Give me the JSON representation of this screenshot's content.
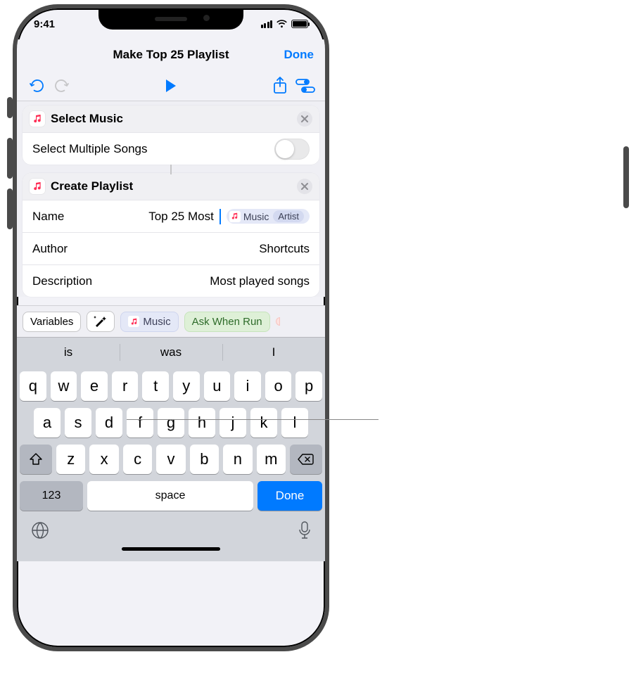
{
  "status": {
    "time": "9:41"
  },
  "header": {
    "title": "Make Top 25 Playlist",
    "done": "Done"
  },
  "actions": {
    "select_music": {
      "title": "Select Music",
      "option_label": "Select Multiple Songs",
      "option_on": false
    },
    "create_playlist": {
      "title": "Create Playlist",
      "fields": {
        "name_label": "Name",
        "name_text": "Top 25 Most ",
        "name_var": "Music",
        "name_subvar": "Artist",
        "author_label": "Author",
        "author_placeholder": "Shortcuts",
        "desc_label": "Description",
        "desc_value": "Most played songs"
      }
    }
  },
  "varbar": {
    "variables": "Variables",
    "music": "Music",
    "ask": "Ask When Run"
  },
  "predictive": [
    "is",
    "was",
    "I"
  ],
  "keyboard": {
    "row1": [
      "q",
      "w",
      "e",
      "r",
      "t",
      "y",
      "u",
      "i",
      "o",
      "p"
    ],
    "row2": [
      "a",
      "s",
      "d",
      "f",
      "g",
      "h",
      "j",
      "k",
      "l"
    ],
    "row3": [
      "z",
      "x",
      "c",
      "v",
      "b",
      "n",
      "m"
    ],
    "num": "123",
    "space": "space",
    "done": "Done"
  }
}
